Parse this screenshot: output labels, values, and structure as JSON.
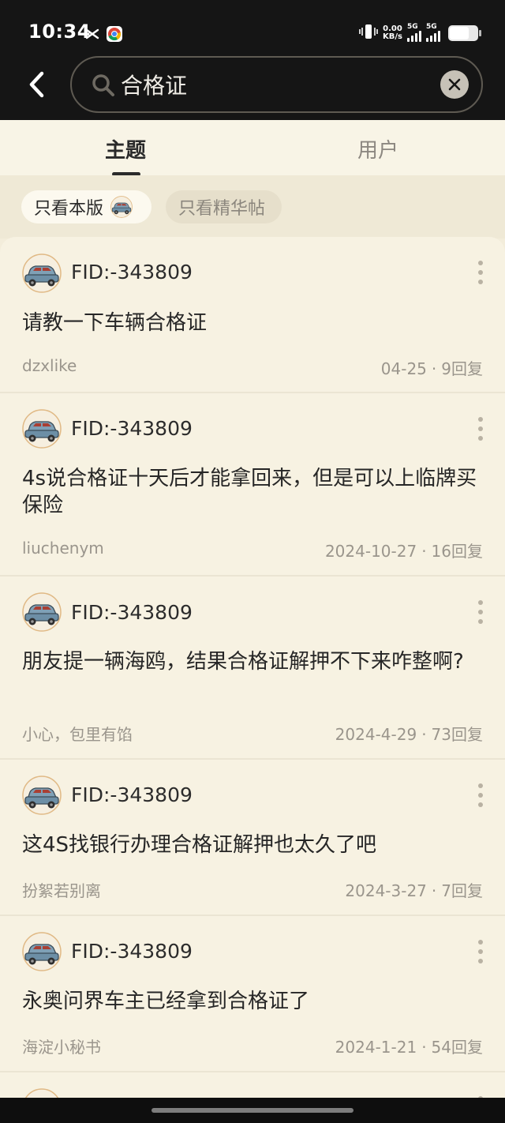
{
  "status_bar": {
    "time": "10:34",
    "net_speed_value": "0.00",
    "net_speed_unit": "KB/s",
    "sim1": "5G",
    "sim2": "5G"
  },
  "search": {
    "query": "合格证",
    "back_icon": "back-arrow-icon",
    "search_icon": "magnifier-icon",
    "clear_icon": "clear-x-icon"
  },
  "tabs": [
    {
      "label": "主题",
      "active": true
    },
    {
      "label": "用户",
      "active": false
    }
  ],
  "filters": {
    "only_this_board": "只看本版",
    "only_featured": "只看精华帖"
  },
  "colors": {
    "header_bg": "#151515",
    "page_bg": "#f7f2e2",
    "text": "#262626",
    "muted": "#9a958c"
  },
  "posts": [
    {
      "fid": "FID:-343809",
      "title": "请教一下车辆合格证",
      "author": "dzxlike",
      "date": "04-25",
      "replies": "9回复"
    },
    {
      "fid": "FID:-343809",
      "title": "4s说合格证十天后才能拿回来，但是可以上临牌买保险",
      "author": "liuchenym",
      "date": "2024-10-27",
      "replies": "16回复"
    },
    {
      "fid": "FID:-343809",
      "title": "朋友提一辆海鸥，结果合格证解押不下来咋整啊?",
      "author": "小心，包里有馅",
      "date": "2024-4-29",
      "replies": "73回复"
    },
    {
      "fid": "FID:-343809",
      "title": "这4S找银行办理合格证解押也太久了吧",
      "author": "扮絮若别离",
      "date": "2024-3-27",
      "replies": "7回复"
    },
    {
      "fid": "FID:-343809",
      "title": "永奥问界车主已经拿到合格证了",
      "author": "海淀小秘书",
      "date": "2024-1-21",
      "replies": "54回复"
    }
  ]
}
